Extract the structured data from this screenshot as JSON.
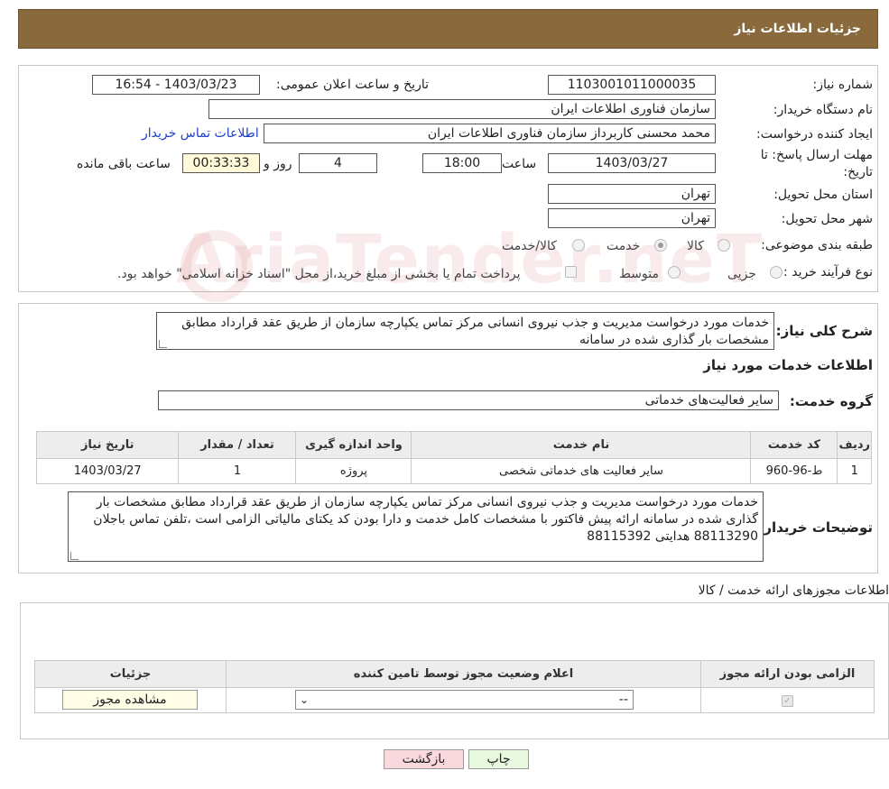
{
  "header": {
    "title": "جزئیات اطلاعات نیاز"
  },
  "form": {
    "need_number_label": "شماره نیاز:",
    "need_number": "1103001011000035",
    "announce_label": "تاریخ و ساعت اعلان عمومی:",
    "announce_value": "1403/03/23 - 16:54",
    "buyer_org_label": "نام دستگاه خریدار:",
    "buyer_org": "سازمان فناوری اطلاعات ایران",
    "creator_label": "ایجاد کننده درخواست:",
    "creator": "محمد محسنی کاربرداز سازمان فناوری اطلاعات ایران",
    "contact_link": "اطلاعات تماس خریدار",
    "deadline_label": "مهلت ارسال پاسخ: تا تاریخ:",
    "deadline_date": "1403/03/27",
    "time_label": "ساعت",
    "deadline_time": "18:00",
    "days_value": "4",
    "days_label": "روز و",
    "remaining_time": "00:33:33",
    "remaining_label": "ساعت باقی مانده",
    "province_label": "استان محل تحویل:",
    "province": "تهران",
    "city_label": "شهر محل تحویل:",
    "city": "تهران",
    "category_label": "طبقه بندی موضوعی:",
    "category_options": [
      "کالا",
      "خدمت",
      "کالا/خدمت"
    ],
    "category_selected": "خدمت",
    "purchase_label": "نوع فرآیند خرید :",
    "purchase_options": [
      "جزیی",
      "متوسط"
    ],
    "purchase_note": "پرداخت تمام یا بخشی از مبلغ خرید،از محل \"اسناد خزانه اسلامی\" خواهد بود."
  },
  "summary": {
    "label": "شرح کلی نیاز:",
    "text": "خدمات مورد درخواست مدیریت و جذب نیروی انسانی مرکز تماس یکپارچه سازمان از طریق عقد قرارداد مطابق مشخصات بار گذاری شده در سامانه",
    "services_heading": "اطلاعات خدمات مورد نیاز",
    "group_label": "گروه خدمت:",
    "group_value": "سایر فعالیت‌های خدماتی"
  },
  "services_table": {
    "headers": [
      "ردیف",
      "کد خدمت",
      "نام خدمت",
      "واحد اندازه گیری",
      "تعداد / مقدار",
      "تاریخ نیاز"
    ],
    "rows": [
      [
        "1",
        "ط-96-960",
        "سایر فعالیت های خدماتی شخصی",
        "پروژه",
        "1",
        "1403/03/27"
      ]
    ]
  },
  "buyer_notes": {
    "label": "توضیحات خریدار:",
    "text": "خدمات مورد درخواست مدیریت و جذب نیروی انسانی مرکز تماس یکپارچه سازمان از طریق عقد قرارداد مطابق مشخصات بار گذاری شده در سامانه ارائه پیش فاکتور با مشخصات کامل خدمت و دارا بودن کد یکتای مالیاتی الزامی است ،تلفن تماس باجلان 88113290 هدایتی 88115392"
  },
  "permits": {
    "heading": "اطلاعات مجوزهای ارائه خدمت / کالا",
    "headers": [
      "الزامی بودن ارائه مجوز",
      "اعلام وضعیت مجوز توسط تامین کننده",
      "جزئیات"
    ],
    "select_value": "--",
    "view_button": "مشاهده مجوز"
  },
  "buttons": {
    "print": "چاپ",
    "back": "بازگشت"
  },
  "watermark": "AriaTender.neT",
  "colors": {
    "header_bg": "#8a6a3c",
    "back_bg": "#f9d9dd",
    "print_bg": "#e9f9df",
    "view_bg": "#fffde6",
    "remaining_bg": "#fff9d8"
  }
}
